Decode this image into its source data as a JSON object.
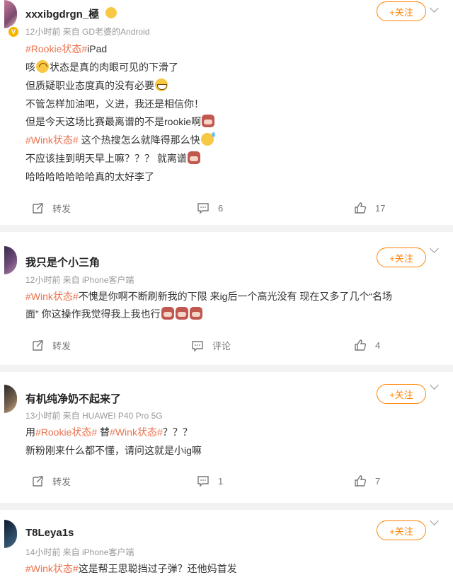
{
  "posts": [
    {
      "username": "xxxibgdrgn_極",
      "verified": "V",
      "meta": "12小时前  来自 GD老婆的Android",
      "follow": "+关注",
      "lines": {
        "l1_tag": "#Rookie状态#",
        "l1_rest": "iPad",
        "l2a": "咳",
        "l2b": "状态是真的肉眼可见的下滑了",
        "l3": "但质疑职业态度真的没有必要",
        "l4": "不管怎样加油吧，义进，我还是相信你！",
        "l5": "但是今天这场比赛最离谱的不是rookie啊",
        "l6_tag": "#Wink状态#",
        "l6_rest": " 这个热搜怎么就降得那么快",
        "l7": "不应该挂到明天早上嘛？？？ 就离谱",
        "l8": "哈哈哈哈哈哈哈真的太好李了"
      },
      "repost": "转发",
      "comments": "6",
      "likes": "17"
    },
    {
      "username": "我只是个小三角",
      "meta": "12小时前  来自 iPhone客户端",
      "follow": "+关注",
      "lines": {
        "l1_tag": "#Wink状态#",
        "l1_rest": "不愧是你啊不断刷新我的下限 来ig后一个高光没有 现在又多了几个“名场",
        "l2": "面” 你这操作我觉得我上我也行"
      },
      "repost": "转发",
      "comments": "评论",
      "likes": "4"
    },
    {
      "username": "有机纯净奶不起来了",
      "meta": "13小时前  来自 HUAWEI P40 Pro 5G",
      "follow": "+关注",
      "lines": {
        "l1_pre": "用",
        "l1_tag1": "#Rookie状态#",
        "l1_mid": " 替",
        "l1_tag2": "#Wink状态#",
        "l1_rest": "？？？",
        "l2": "新粉刚来什么都不懂，请问这就是小ig嘛"
      },
      "repost": "转发",
      "comments": "1",
      "likes": "7"
    },
    {
      "username": "T8Leya1s",
      "meta": "14小时前  来自 iPhone客户端",
      "follow": "+关注",
      "lines": {
        "l1_tag": "#Wink状态#",
        "l1_rest": "这是帮王思聪挡过子弹？还他妈首发"
      }
    }
  ],
  "icons": {
    "repost": "repost-icon",
    "comment": "comment-icon",
    "like": "like-icon",
    "more": "chevron-down-icon"
  },
  "colors": {
    "accent": "#ff8200",
    "tag": "#eb7350"
  }
}
